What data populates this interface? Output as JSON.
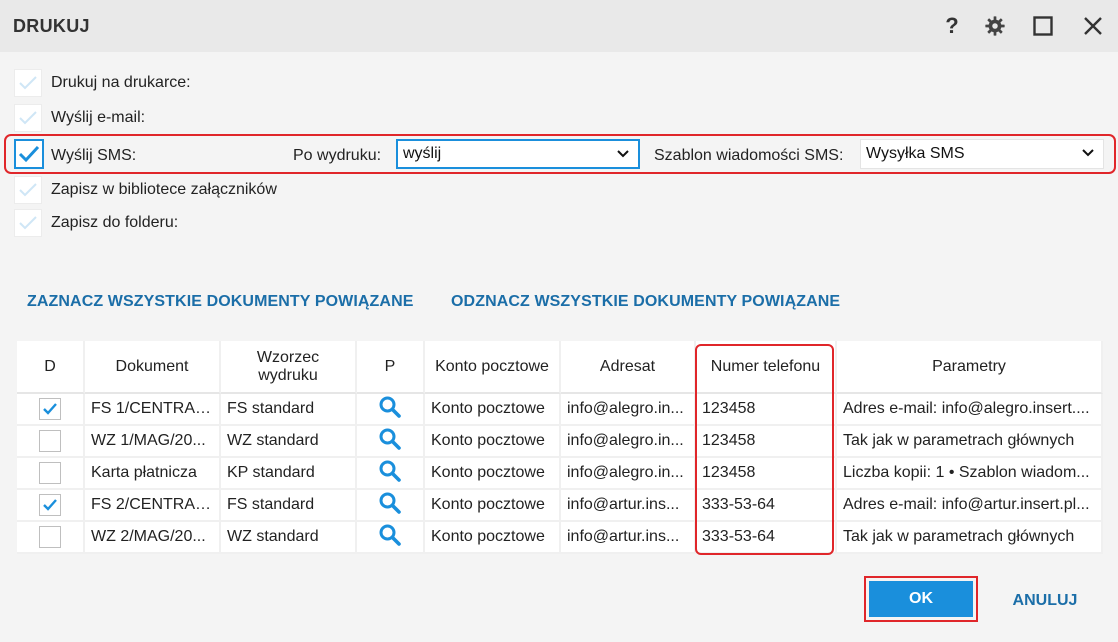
{
  "window": {
    "title": "DRUKUJ",
    "help_label": "?"
  },
  "options": {
    "print": "Drukuj na drukarce:",
    "email": "Wyślij e-mail:",
    "sms": "Wyślij SMS:",
    "library": "Zapisz w bibliotece załączników",
    "folder": "Zapisz do folderu:"
  },
  "sms_settings": {
    "after_print_label": "Po wydruku:",
    "after_print_value": "wyślij",
    "template_label": "Szablon wiadomości SMS:",
    "template_value": "Wysyłka SMS"
  },
  "links": {
    "select_all": "ZAZNACZ WSZYSTKIE DOKUMENTY POWIĄZANE",
    "deselect_all": "ODZNACZ WSZYSTKIE DOKUMENTY POWIĄZANE"
  },
  "table": {
    "headers": {
      "d": "D",
      "dokument": "Dokument",
      "wzorzec": "Wzorzec wydruku",
      "p": "P",
      "konto": "Konto pocztowe",
      "adresat": "Adresat",
      "telefon": "Numer telefonu",
      "parametry": "Parametry"
    },
    "rows": [
      {
        "checked": true,
        "dokument": "FS 1/CENTRAL...",
        "wzorzec": "FS standard",
        "konto": "Konto pocztowe",
        "adresat": "info@alegro.in...",
        "telefon": "123458",
        "parametry": "Adres e-mail: info@alegro.insert...."
      },
      {
        "checked": false,
        "dokument": "WZ 1/MAG/20...",
        "wzorzec": "WZ standard",
        "konto": "Konto pocztowe",
        "adresat": "info@alegro.in...",
        "telefon": "123458",
        "parametry": "Tak jak w parametrach głównych"
      },
      {
        "checked": false,
        "dokument": "Karta płatnicza",
        "wzorzec": "KP standard",
        "konto": "Konto pocztowe",
        "adresat": "info@alegro.in...",
        "telefon": "123458",
        "parametry": "Liczba kopii: 1 • Szablon wiadom..."
      },
      {
        "checked": true,
        "dokument": "FS 2/CENTRAL...",
        "wzorzec": "FS standard",
        "konto": "Konto pocztowe",
        "adresat": "info@artur.ins...",
        "telefon": "333-53-64",
        "parametry": "Adres e-mail: info@artur.insert.pl..."
      },
      {
        "checked": false,
        "dokument": "WZ 2/MAG/20...",
        "wzorzec": "WZ standard",
        "konto": "Konto pocztowe",
        "adresat": "info@artur.ins...",
        "telefon": "333-53-64",
        "parametry": "Tak jak w parametrach głównych"
      }
    ]
  },
  "buttons": {
    "ok": "OK",
    "cancel": "ANULUJ"
  },
  "colors": {
    "accent": "#1a8fdc",
    "link": "#1b6ea8",
    "highlight": "#e0262a",
    "checkmark_faded": "#cfe6f6"
  },
  "icons": [
    "help-icon",
    "gear-icon",
    "maximize-icon",
    "close-icon",
    "check-icon",
    "chevron-down-icon",
    "search-icon"
  ]
}
